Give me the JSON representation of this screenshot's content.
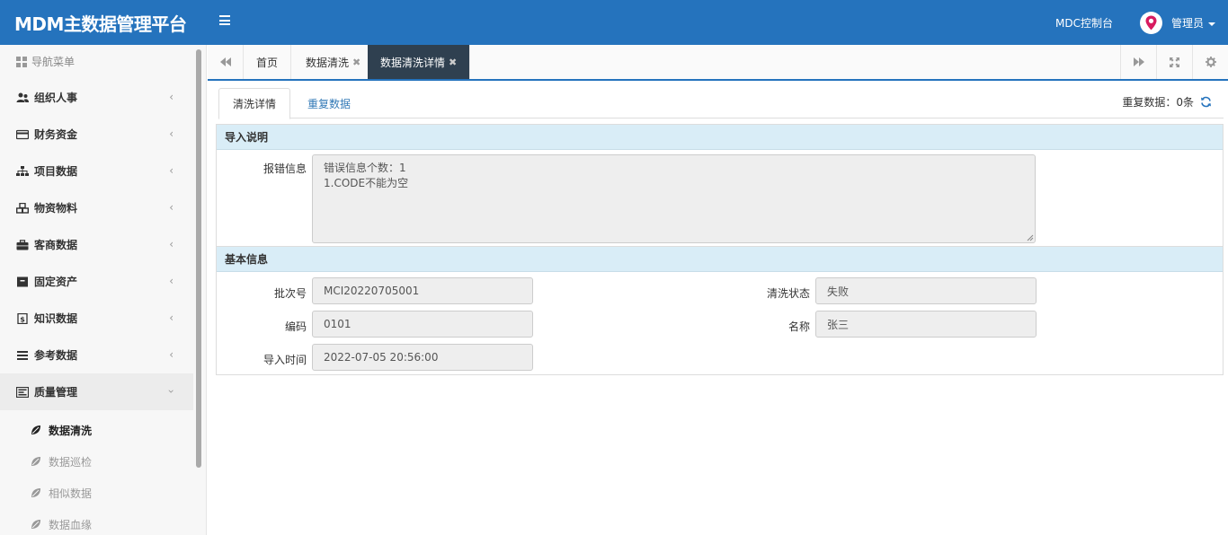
{
  "header": {
    "title": "MDM主数据管理平台",
    "console_label": "MDC控制台",
    "user_label": "管理员",
    "avatar_icon": "map-pin-icon",
    "colors": {
      "header_bg": "#2573bd",
      "avatar_accent": "#d81b60"
    }
  },
  "sidebar": {
    "heading": "导航菜单",
    "items": [
      {
        "label": "组织人事",
        "icon": "users-icon",
        "chevron": "‹"
      },
      {
        "label": "财务资金",
        "icon": "credit-card-icon",
        "chevron": "‹"
      },
      {
        "label": "项目数据",
        "icon": "sitemap-icon",
        "chevron": "‹"
      },
      {
        "label": "物资物料",
        "icon": "cubes-icon",
        "chevron": "‹"
      },
      {
        "label": "客商数据",
        "icon": "briefcase-icon",
        "chevron": "‹"
      },
      {
        "label": "固定资产",
        "icon": "archive-icon",
        "chevron": "‹"
      },
      {
        "label": "知识数据",
        "icon": "book-icon",
        "chevron": "‹"
      },
      {
        "label": "参考数据",
        "icon": "list-icon",
        "chevron": "‹"
      },
      {
        "label": "质量管理",
        "icon": "tasks-icon",
        "chevron": "›"
      }
    ],
    "subitems": [
      {
        "label": "数据清洗",
        "active": true
      },
      {
        "label": "数据巡检",
        "active": false
      },
      {
        "label": "相似数据",
        "active": false
      },
      {
        "label": "数据血缘",
        "active": false
      }
    ]
  },
  "tabbar": {
    "tabs": [
      {
        "label": "首页",
        "closable": false,
        "active": false
      },
      {
        "label": "数据清洗",
        "closable": true,
        "active": false
      },
      {
        "label": "数据清洗详情",
        "closable": true,
        "active": true
      }
    ],
    "close_glyph": "✖"
  },
  "content": {
    "subtabs": [
      {
        "label": "清洗详情",
        "active": true
      },
      {
        "label": "重复数据",
        "active": false
      }
    ],
    "duplicate_label": "重复数据：0条",
    "import_section": {
      "title": "导入说明",
      "error_label": "报错信息",
      "error_lines": [
        "错误信息个数：1",
        "1.CODE不能为空"
      ]
    },
    "basic_section": {
      "title": "基本信息",
      "batch_label": "批次号",
      "batch_value": "MCI20220705001",
      "status_label": "清洗状态",
      "status_value": "失败",
      "code_label": "编码",
      "code_value": "0101",
      "name_label": "名称",
      "name_value": "张三",
      "time_label": "导入时间",
      "time_value": "2022-07-05 20:56:00"
    }
  }
}
